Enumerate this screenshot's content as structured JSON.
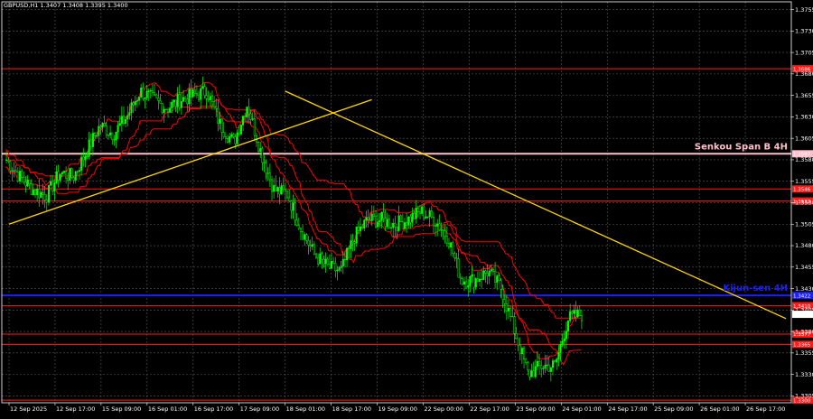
{
  "window_title": "GBPUSD,H1  1.3407 1.3408 1.3395 1.3400",
  "colors": {
    "background": "#000000",
    "grid": "#5a5a5a",
    "axis": "#ffffff",
    "candle": "#00ff00",
    "ichimoku": "#ff0000",
    "trendline": "#ffd700",
    "level": "#ff1a1a",
    "senkou": "#ffc0cb",
    "kijun": "#1e1eff",
    "price_box": "#ffffff"
  },
  "chart_data": {
    "type": "candlestick",
    "symbol": "GBPUSD",
    "timeframe": "H1",
    "ohlc_header": {
      "open": 1.3407,
      "high": 1.3408,
      "low": 1.3395,
      "close": 1.34
    },
    "ylim": [
      1.3297,
      1.3764
    ],
    "y_ticks": [
      "1.3755",
      "1.3730",
      "1.3705",
      "1.3680",
      "1.3655",
      "1.3630",
      "1.3605",
      "1.3580",
      "1.3555",
      "1.3530",
      "1.3505",
      "1.3480",
      "1.3455",
      "1.3430",
      "1.3405",
      "1.3380",
      "1.3355",
      "1.3330",
      "1.3305"
    ],
    "x_ticks": [
      "12 Sep 2025",
      "12 Sep 17:00",
      "15 Sep 09:00",
      "16 Sep 01:00",
      "16 Sep 17:00",
      "17 Sep 09:00",
      "18 Sep 01:00",
      "18 Sep 17:00",
      "19 Sep 09:00",
      "22 Sep 00:00",
      "22 Sep 17:00",
      "23 Sep 09:00",
      "24 Sep 01:00",
      "24 Sep 17:00",
      "25 Sep 09:00",
      "26 Sep 01:00",
      "26 Sep 17:00"
    ],
    "close_path": [
      1.358,
      1.356,
      1.3545,
      1.3538,
      1.3565,
      1.356,
      1.359,
      1.362,
      1.361,
      1.363,
      1.366,
      1.365,
      1.364,
      1.365,
      1.3655,
      1.366,
      1.362,
      1.36,
      1.3645,
      1.359,
      1.3545,
      1.354,
      1.35,
      1.347,
      1.3455,
      1.345,
      1.349,
      1.351,
      1.351,
      1.3505,
      1.351,
      1.352,
      1.351,
      1.349,
      1.344,
      1.344,
      1.345,
      1.343,
      1.338,
      1.333,
      1.334,
      1.334,
      1.3395,
      1.34
    ],
    "levels": [
      {
        "label": "1.3686",
        "value": 1.3686,
        "type": "level"
      },
      {
        "label": "1.3587",
        "value": 1.3587,
        "type": "senkou"
      },
      {
        "label": "1.3546",
        "value": 1.3546,
        "type": "level"
      },
      {
        "label": "1.3532",
        "value": 1.3532,
        "type": "level"
      },
      {
        "label": "1.3422",
        "value": 1.3422,
        "type": "kijun"
      },
      {
        "label": "1.3410",
        "value": 1.341,
        "type": "level"
      },
      {
        "label": "1.3400",
        "value": 1.34,
        "type": "price"
      },
      {
        "label": "1.3377",
        "value": 1.3377,
        "type": "level"
      },
      {
        "label": "1.3365",
        "value": 1.3365,
        "type": "level"
      },
      {
        "label": "1.3300",
        "value": 1.33,
        "type": "level"
      }
    ],
    "trendlines": [
      {
        "from": {
          "x": "12 Sep 2025",
          "y": 1.3505
        },
        "to": {
          "x": "18 Sep 17:00",
          "y": 1.365
        }
      },
      {
        "from": {
          "x": "18 Sep 01:00",
          "y": 1.366
        },
        "to": {
          "x": "26 Sep 17:00",
          "y": 1.3395
        }
      }
    ],
    "annotations": [
      {
        "text": "Senkou Span B 4H",
        "value": 1.3587
      },
      {
        "text": "Kijun-sen 4H",
        "value": 1.3422
      }
    ]
  }
}
